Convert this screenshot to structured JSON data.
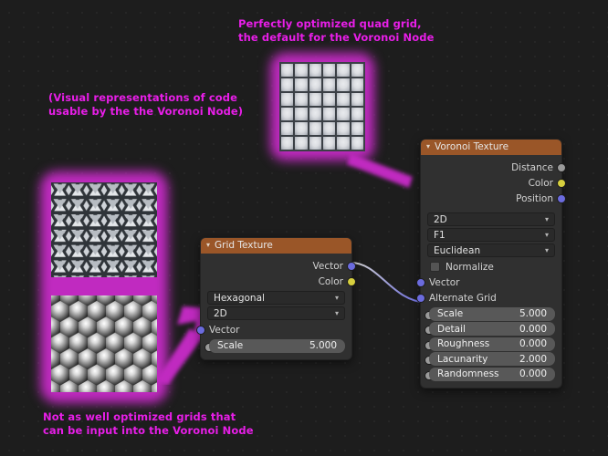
{
  "annotations": {
    "top": "Perfectly optimized quad grid,\nthe default for the Voronoi Node",
    "left": "(Visual representations of code\nusable by the the Voronoi Node)",
    "bottom": "Not as well optimized grids that\ncan be input into the Voronoi Node",
    "color": "#e81ee8"
  },
  "grid_node": {
    "title": "Grid Texture",
    "outputs": [
      {
        "label": "Vector",
        "socket": "purple"
      },
      {
        "label": "Color",
        "socket": "yellow"
      }
    ],
    "dropdowns": [
      {
        "value": "Hexagonal"
      },
      {
        "value": "2D"
      }
    ],
    "inputs": [
      {
        "label": "Vector",
        "socket": "purple"
      }
    ],
    "fields": [
      {
        "label": "Scale",
        "value": "5.000",
        "socket": "gray"
      }
    ]
  },
  "voronoi_node": {
    "title": "Voronoi Texture",
    "outputs": [
      {
        "label": "Distance",
        "socket": "gray"
      },
      {
        "label": "Color",
        "socket": "yellow"
      },
      {
        "label": "Position",
        "socket": "purple"
      }
    ],
    "dropdowns": [
      {
        "value": "2D"
      },
      {
        "value": "F1"
      },
      {
        "value": "Euclidean"
      }
    ],
    "checkbox": {
      "label": "Normalize",
      "checked": false
    },
    "inputs": [
      {
        "label": "Vector",
        "socket": "purple"
      },
      {
        "label": "Alternate Grid",
        "socket": "purple"
      }
    ],
    "fields": [
      {
        "label": "Scale",
        "value": "5.000",
        "socket": "gray"
      },
      {
        "label": "Detail",
        "value": "0.000",
        "socket": "gray"
      },
      {
        "label": "Roughness",
        "value": "0.000",
        "socket": "gray"
      },
      {
        "label": "Lacunarity",
        "value": "2.000",
        "socket": "gray"
      },
      {
        "label": "Randomness",
        "value": "0.000",
        "socket": "gray"
      }
    ]
  },
  "textures": {
    "quad": {
      "name": "quad-grid-preview",
      "rows": 6,
      "cols": 6
    },
    "triangle": {
      "name": "triangle-grid-preview"
    },
    "hexagon": {
      "name": "hexagon-grid-preview"
    }
  },
  "theme": {
    "background": "#1d1d1d",
    "node_header": "#9a5628",
    "node_body": "#303030",
    "highlight": "#c02ac0",
    "socket_gray": "#9a9a9a",
    "socket_yellow": "#d6cf3e",
    "socket_purple": "#6b6bde"
  }
}
